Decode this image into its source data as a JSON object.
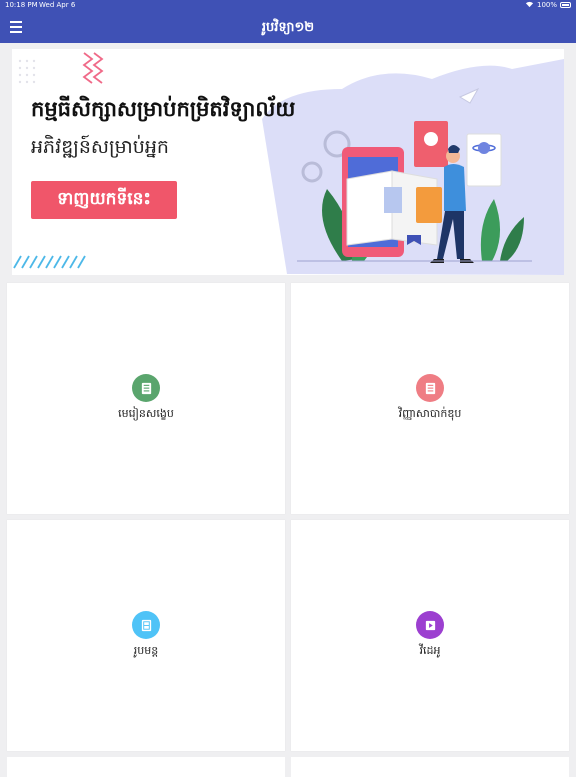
{
  "status_bar": {
    "time": "10:18 PM",
    "date": "Wed Apr 6",
    "battery": "100%"
  },
  "app_bar": {
    "title": "រូបវិទ្យា១២"
  },
  "banner": {
    "headline": "កម្មធីសិក្សាសម្រាប់កម្រិតវិទ្យាល័យ",
    "subline": "អភិវឌ្ឍន៍សម្រាប់អ្នក",
    "cta_label": "ទាញយកទីនេះ"
  },
  "cards": [
    {
      "label": "មេរៀនសង្ខេប",
      "icon": "book-icon",
      "color": "#5aa56d"
    },
    {
      "label": "វិញ្ញាសាបាក់ឌុប",
      "icon": "exam-book-icon",
      "color": "#ef7d84"
    },
    {
      "label": "រូបមន្ត",
      "icon": "formula-icon",
      "color": "#4fc3f7"
    },
    {
      "label": "វីដេអូ",
      "icon": "video-icon",
      "color": "#9c3fd0"
    }
  ],
  "colors": {
    "app_bar": "#3f51b5",
    "cta": "#f0566a",
    "background": "#efeff1"
  }
}
